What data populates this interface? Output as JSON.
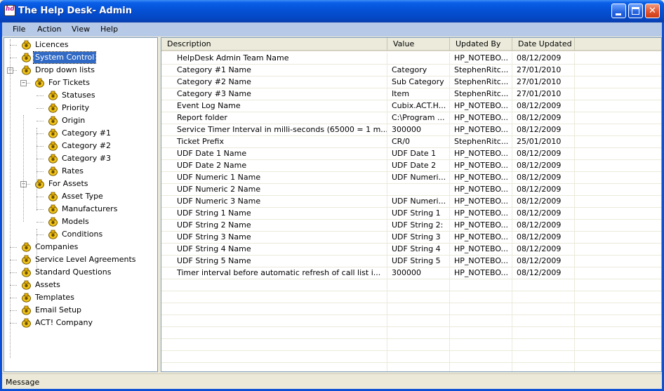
{
  "window": {
    "title": "The Help Desk- Admin",
    "icon_text": "hd"
  },
  "menu": {
    "items": [
      "File",
      "Action",
      "View",
      "Help"
    ]
  },
  "tree": {
    "items": [
      {
        "label": "Licences",
        "level": 0
      },
      {
        "label": "System Control",
        "level": 0,
        "selected": true
      },
      {
        "label": "Drop down lists",
        "level": 0,
        "expander": "-"
      },
      {
        "label": "For Tickets",
        "level": 1,
        "expander": "-"
      },
      {
        "label": "Statuses",
        "level": 2
      },
      {
        "label": "Priority",
        "level": 2
      },
      {
        "label": "Origin",
        "level": 2
      },
      {
        "label": "Category #1",
        "level": 2
      },
      {
        "label": "Category #2",
        "level": 2
      },
      {
        "label": "Category #3",
        "level": 2
      },
      {
        "label": "Rates",
        "level": 2
      },
      {
        "label": "For Assets",
        "level": 1,
        "expander": "-"
      },
      {
        "label": "Asset Type",
        "level": 2
      },
      {
        "label": "Manufacturers",
        "level": 2
      },
      {
        "label": "Models",
        "level": 2
      },
      {
        "label": "Conditions",
        "level": 2
      },
      {
        "label": "Companies",
        "level": 0
      },
      {
        "label": "Service Level Agreements",
        "level": 0
      },
      {
        "label": "Standard Questions",
        "level": 0
      },
      {
        "label": "Assets",
        "level": 0
      },
      {
        "label": "Templates",
        "level": 0
      },
      {
        "label": "Email Setup",
        "level": 0
      },
      {
        "label": "ACT! Company",
        "level": 0
      }
    ]
  },
  "grid": {
    "columns": [
      "Description",
      "Value",
      "Updated By",
      "Date Updated"
    ],
    "rows": [
      [
        "HelpDesk Admin Team Name",
        "",
        "HP_NOTEBO...",
        "08/12/2009"
      ],
      [
        "Category #1 Name",
        "Category",
        "StephenRitc...",
        "27/01/2010"
      ],
      [
        "Category #2 Name",
        "Sub Category",
        "StephenRitc...",
        "27/01/2010"
      ],
      [
        "Category #3 Name",
        "Item",
        "StephenRitc...",
        "27/01/2010"
      ],
      [
        "Event Log Name",
        "Cubix.ACT.H...",
        "HP_NOTEBO...",
        "08/12/2009"
      ],
      [
        "Report folder",
        "C:\\Program ...",
        "HP_NOTEBO...",
        "08/12/2009"
      ],
      [
        "Service Timer Interval in milli-seconds (65000 = 1 m...",
        "300000",
        "HP_NOTEBO...",
        "08/12/2009"
      ],
      [
        "Ticket Prefix",
        "CR/0",
        "StephenRitc...",
        "25/01/2010"
      ],
      [
        "UDF Date 1 Name",
        "UDF Date 1",
        "HP_NOTEBO...",
        "08/12/2009"
      ],
      [
        "UDF Date 2 Name",
        "UDF Date 2",
        "HP_NOTEBO...",
        "08/12/2009"
      ],
      [
        "UDF Numeric 1 Name",
        "UDF Numeri...",
        "HP_NOTEBO...",
        "08/12/2009"
      ],
      [
        "UDF Numeric 2 Name",
        "",
        "HP_NOTEBO...",
        "08/12/2009"
      ],
      [
        "UDF Numeric 3 Name",
        "UDF Numeri...",
        "HP_NOTEBO...",
        "08/12/2009"
      ],
      [
        "UDF String 1 Name",
        "UDF String 1",
        "HP_NOTEBO...",
        "08/12/2009"
      ],
      [
        "UDF String 2 Name",
        "UDF String 2:",
        "HP_NOTEBO...",
        "08/12/2009"
      ],
      [
        "UDF String 3 Name",
        "UDF String 3",
        "HP_NOTEBO...",
        "08/12/2009"
      ],
      [
        "UDF String 4 Name",
        "UDF String 4",
        "HP_NOTEBO...",
        "08/12/2009"
      ],
      [
        "UDF String 5 Name",
        "UDF String 5",
        "HP_NOTEBO...",
        "08/12/2009"
      ],
      [
        "Timer interval before automatic refresh of call list i...",
        "300000",
        "HP_NOTEBO...",
        "08/12/2009"
      ]
    ]
  },
  "status": {
    "text": "Message"
  },
  "colors": {
    "title_blue": "#0553d8",
    "menu_bg": "#b6c9e6",
    "selection": "#316ac5",
    "icon_yellow": "#f0c419"
  }
}
